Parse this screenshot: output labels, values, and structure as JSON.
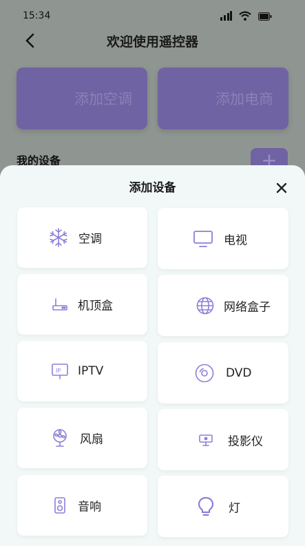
{
  "status_bar": {
    "time": "15:34"
  },
  "header": {
    "title": "欢迎使用遥控器"
  },
  "background": {
    "cards": [
      {
        "label": "添加空调"
      },
      {
        "label": "添加电商"
      }
    ],
    "my_devices_label": "我的设备",
    "add_symbol": "+"
  },
  "sheet": {
    "title": "添加设备",
    "close_symbol": "×",
    "devices": [
      {
        "label": "空调",
        "icon": "snowflake-icon"
      },
      {
        "label": "电视",
        "icon": "tv-icon"
      },
      {
        "label": "机顶盒",
        "icon": "set-top-box-icon"
      },
      {
        "label": "网络盒子",
        "icon": "globe-icon"
      },
      {
        "label": "IPTV",
        "icon": "iptv-icon"
      },
      {
        "label": "DVD",
        "icon": "disc-icon"
      },
      {
        "label": "风扇",
        "icon": "fan-icon"
      },
      {
        "label": "投影仪",
        "icon": "projector-icon"
      },
      {
        "label": "音响",
        "icon": "speaker-icon"
      },
      {
        "label": "灯",
        "icon": "bulb-icon"
      }
    ]
  },
  "colors": {
    "accent": "#8b7fd8",
    "sheet_bg": "#f1f8f7",
    "card_purple": "#6f63a3"
  }
}
